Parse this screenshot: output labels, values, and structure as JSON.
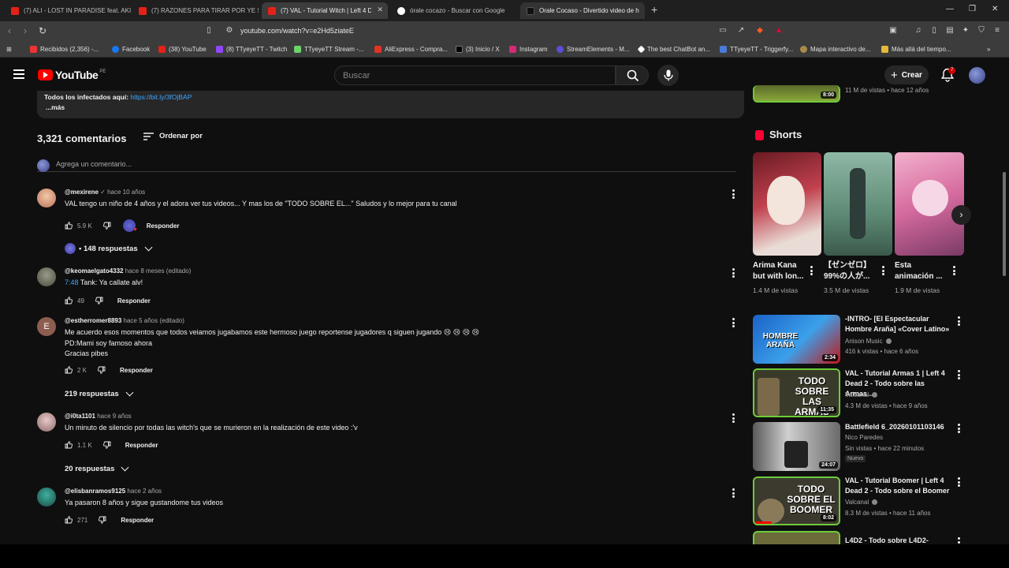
{
  "tabs": [
    {
      "title": "(7) ALI - LOST IN PARADISE feat. AKI"
    },
    {
      "title": "(7) RAZONES PARA TIRAR POR YE SI"
    },
    {
      "title": "(7) VAL - Tutorial Witch | Left 4 D"
    },
    {
      "title": "órale cocazo - Buscar con Google"
    },
    {
      "title": "Orale Cocaso - Divertido video de h"
    }
  ],
  "address": {
    "url": "youtube.com/watch?v=e2Hd5ziateE"
  },
  "bookmarks": [
    "Recibidos (2,356) -...",
    "Facebook",
    "(38) YouTube",
    "(8) TTyeyeTT - Twitch",
    "TTyeyeTT Stream -...",
    "AliExpress - Compra...",
    "(3) Inicio / X",
    "Instagram",
    "StreamElements - M...",
    "The best ChatBot an...",
    "TTyeyeTT - Triggerfy...",
    "Mapa interactivo de...",
    "Más allá del tiempo..."
  ],
  "header": {
    "logo": "YouTube",
    "country": "PE",
    "search_placeholder": "Buscar",
    "create_label": "Crear",
    "notif_count": "7"
  },
  "description": {
    "line": "Todos los infectados aquí:",
    "link": "https://bit.ly/3fOjBAP",
    "more": "...más"
  },
  "comments_section": {
    "count_label": "3,321 comentarios",
    "sort_label": "Ordenar por",
    "add_placeholder": "Agrega un comentario..."
  },
  "comments": [
    {
      "author": "@mexirene",
      "time": "hace 10 años",
      "lines": [
        "VAL tengo un niño de 4 años y el adora ver tus videos... Y mas los de \"TODO SOBRE EL...\" Saludos y lo mejor para tu canal"
      ],
      "likes": "5.9 K",
      "reply": "Responder",
      "replies": "148 respuestas"
    },
    {
      "author": "@keomaelgato4332",
      "time": "hace 8 meses (editado)",
      "timestamp": "7:48",
      "lines": [
        "Tank: Ya callate alv!"
      ],
      "likes": "49",
      "reply": "Responder",
      "replies": ""
    },
    {
      "author": "@estherromer8893",
      "time": "hace 5 años (editado)",
      "lines": [
        "Me acuerdo esos momentos que todos veiamos jugabamos este hermoso juego reportense jugadores q siguen jugando 😢 😢 😢 😢",
        "PD:Mami soy famoso ahora",
        "Gracias pibes"
      ],
      "likes": "2 K",
      "reply": "Responder",
      "replies": "219 respuestas"
    },
    {
      "author": "@i0ta1101",
      "time": "hace 9 años",
      "lines": [
        "Un minuto de silencio por todas las witch's que se murieron en la realización de este video :'v"
      ],
      "likes": "1.1 K",
      "reply": "Responder",
      "replies": "20 respuestas"
    },
    {
      "author": "@elisbanramos9125",
      "time": "hace 2 años",
      "lines": [
        "Ya pasaron 8 años y sigue gustandome tus videos"
      ],
      "likes": "271",
      "reply": "Responder",
      "replies": ""
    }
  ],
  "top_related_views": "11 M de vistas • hace 12 años",
  "top_related_duration": "8:00",
  "shorts": {
    "title": "Shorts",
    "items": [
      {
        "title": "Arima Kana but with lon...",
        "views": "1.4 M de vistas"
      },
      {
        "title": "【ゼンゼロ】99%の人が...",
        "views": "3.5 M de vistas"
      },
      {
        "title": "Esta animación ...",
        "views": "1.9 M de vistas"
      }
    ]
  },
  "related": [
    {
      "title": "-INTRO- [El Espectacular Hombre Araña] «Cover Latino»",
      "channel": "Anison Music",
      "views": "416 k vistas • hace 6 años",
      "duration": "2:34",
      "thumb_text": "HOMBRE ARAÑA"
    },
    {
      "title": "VAL - Tutorial Armas 1 | Left 4 Dead 2 - Todo sobre las Armas...",
      "channel": "Valcanal",
      "views": "4.3 M de vistas • hace 9 años",
      "duration": "11:35",
      "thumb_text": "TODO SOBRE LAS ARMAS"
    },
    {
      "title": "Battlefield 6_20260101103146",
      "channel": "Nico Paredes",
      "views": "Sin vistas • hace 22 minutos",
      "duration": "24:07",
      "badge": "Nuevo"
    },
    {
      "title": "VAL - Tutorial Boomer | Left 4 Dead 2 - Todo sobre el Boomer",
      "channel": "Valcanal",
      "views": "8.3 M de vistas • hace 11 años",
      "duration": "8:02",
      "thumb_text": "TODO SOBRE EL BOOMER"
    },
    {
      "title": "L4D2 - Todo sobre L4D2-"
    }
  ]
}
